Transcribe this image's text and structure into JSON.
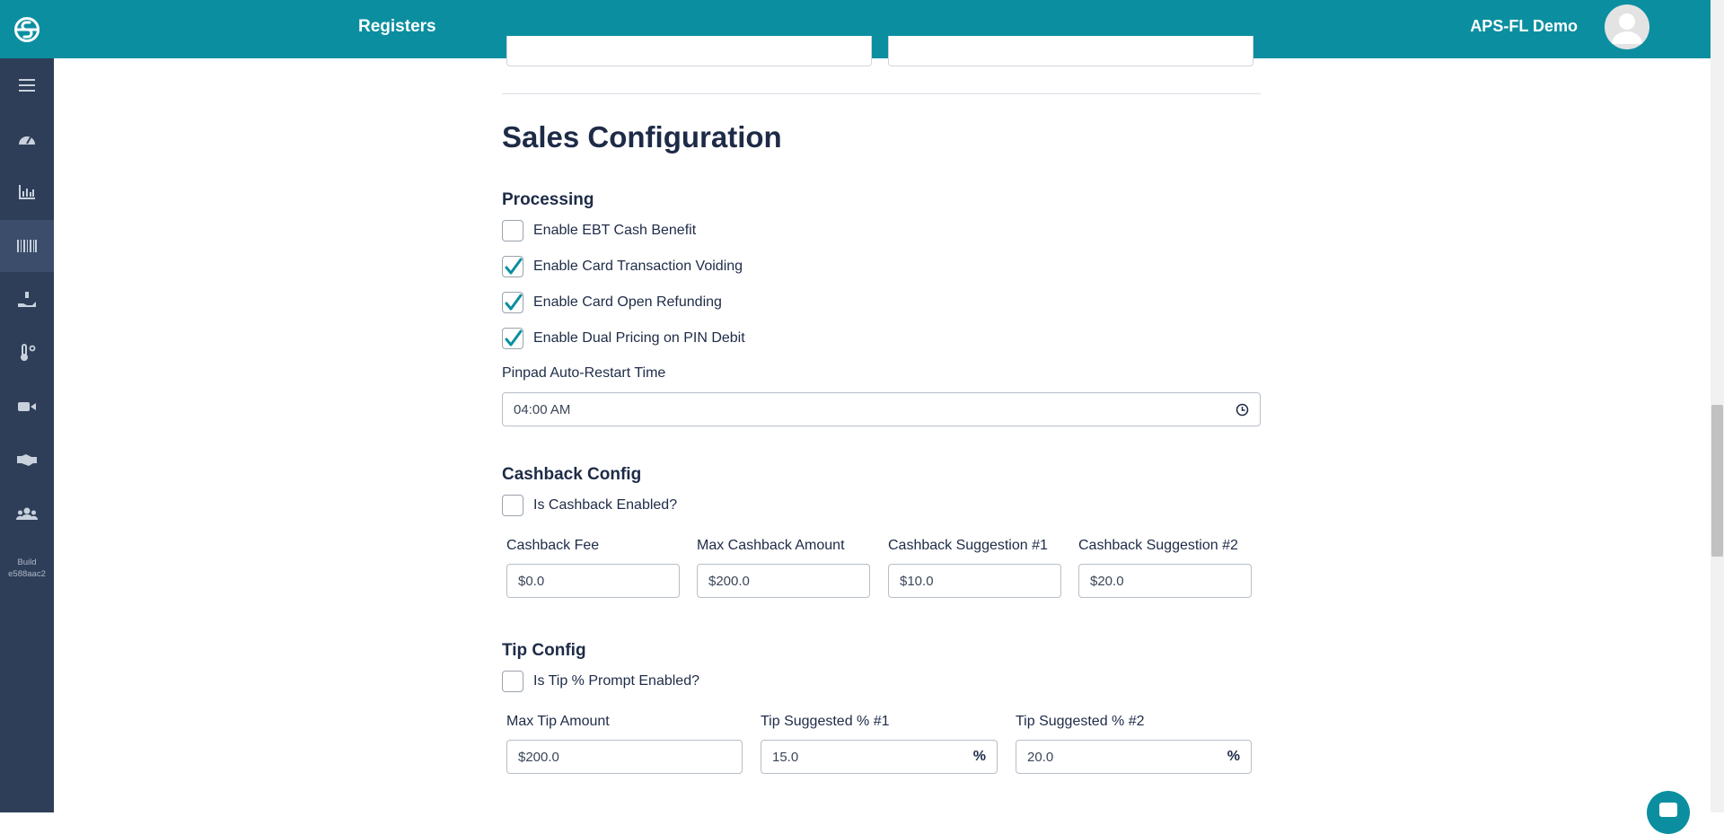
{
  "header": {
    "title": "Registers",
    "account": "APS-FL Demo"
  },
  "sidebar": {
    "items": [
      {
        "icon": "menu-icon"
      },
      {
        "icon": "dashboard-gauge-icon"
      },
      {
        "icon": "bar-chart-icon"
      },
      {
        "icon": "barcode-icon",
        "active": true
      },
      {
        "icon": "hand-money-icon"
      },
      {
        "icon": "thermometer-icon"
      },
      {
        "icon": "video-camera-icon"
      },
      {
        "icon": "handshake-icon"
      },
      {
        "icon": "users-icon"
      }
    ],
    "build_label": "Build",
    "build_id": "e588aac2"
  },
  "sales": {
    "title": "Sales Configuration",
    "processing": {
      "heading": "Processing",
      "options": [
        {
          "label": "Enable EBT Cash Benefit",
          "checked": false
        },
        {
          "label": "Enable Card Transaction Voiding",
          "checked": true
        },
        {
          "label": "Enable Card Open Refunding",
          "checked": true
        },
        {
          "label": "Enable Dual Pricing on PIN Debit",
          "checked": true
        }
      ],
      "restart_label": "Pinpad Auto-Restart Time",
      "restart_value": "04:00  AM"
    },
    "cashback": {
      "heading": "Cashback Config",
      "enabled_label": "Is Cashback Enabled?",
      "enabled": false,
      "fields": [
        {
          "label": "Cashback Fee",
          "value": "$0.0"
        },
        {
          "label": "Max Cashback Amount",
          "value": "$200.0"
        },
        {
          "label": "Cashback Suggestion #1",
          "value": "$10.0"
        },
        {
          "label": "Cashback Suggestion #2",
          "value": "$20.0"
        }
      ]
    },
    "tip": {
      "heading": "Tip Config",
      "enabled_label": "Is Tip % Prompt Enabled?",
      "enabled": false,
      "fields": [
        {
          "label": "Max Tip Amount",
          "value": "$200.0",
          "suffix": ""
        },
        {
          "label": "Tip Suggested % #1",
          "value": "15.0",
          "suffix": "%"
        },
        {
          "label": "Tip Suggested % #2",
          "value": "20.0",
          "suffix": "%"
        }
      ]
    }
  },
  "colors": {
    "brand": "#0b8fa0",
    "sidebar": "#2e3e58",
    "text": "#1e2b47"
  }
}
